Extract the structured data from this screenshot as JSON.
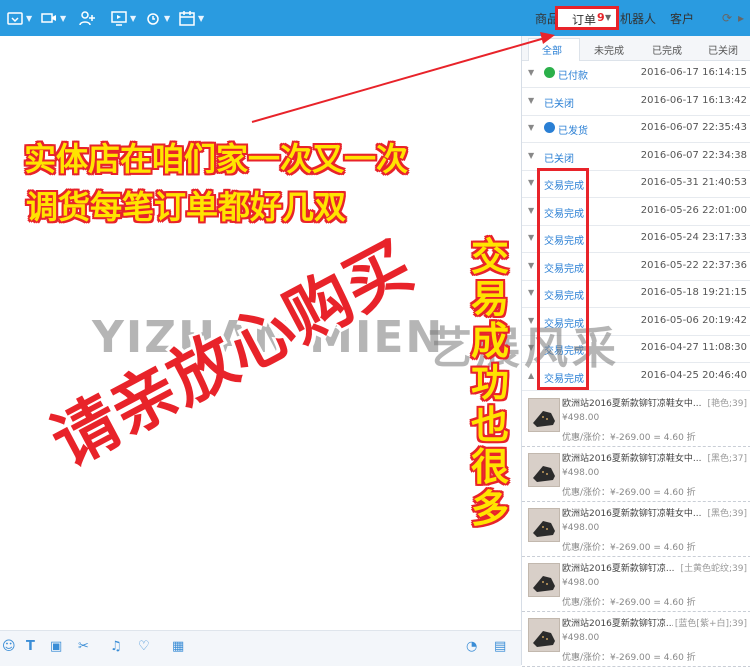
{
  "toolbar": {
    "icons": [
      "folder-icon",
      "video-icon",
      "add-contact-icon",
      "screen-share-icon",
      "alarm-icon",
      "calendar-icon"
    ]
  },
  "tabs": {
    "goods": "商品",
    "orders": "订单",
    "orders_badge": "9",
    "robot": "机器人",
    "customer": "客户"
  },
  "subtabs": {
    "all": "全部",
    "unfinished": "未完成",
    "finished": "已完成",
    "closed": "已关闭"
  },
  "orders": [
    {
      "status": "已付款",
      "date": "2016-06-17 16:14:15",
      "icon": "check-icon",
      "icon_color": "#2bb04a"
    },
    {
      "status": "已关闭",
      "date": "2016-06-17 16:13:42"
    },
    {
      "status": "已发货",
      "date": "2016-06-07 22:35:43",
      "icon": "truck-icon",
      "icon_color": "#2a7fd4"
    },
    {
      "status": "已关闭",
      "date": "2016-06-07 22:34:38"
    },
    {
      "status": "交易完成",
      "date": "2016-05-31 21:40:53"
    },
    {
      "status": "交易完成",
      "date": "2016-05-26 22:01:00"
    },
    {
      "status": "交易完成",
      "date": "2016-05-24 23:17:33"
    },
    {
      "status": "交易完成",
      "date": "2016-05-22 22:37:36"
    },
    {
      "status": "交易完成",
      "date": "2016-05-18 19:21:15"
    },
    {
      "status": "交易完成",
      "date": "2016-05-06 20:19:42"
    },
    {
      "status": "交易完成",
      "date": "2016-04-27 11:08:30"
    },
    {
      "status": "交易完成",
      "date": "2016-04-25 20:46:40"
    }
  ],
  "items": [
    {
      "title": "欧洲站2016夏新款铆钉凉鞋女中...",
      "sku": "[艳色;39]",
      "price": "¥498.00",
      "discount": "优惠/涨价：¥-269.00 = 4.60 折"
    },
    {
      "title": "欧洲站2016夏新款铆钉凉鞋女中...",
      "sku": "[黑色;37]",
      "price": "¥498.00",
      "discount": "优惠/涨价：¥-269.00 = 4.60 折"
    },
    {
      "title": "欧洲站2016夏新款铆钉凉鞋女中...",
      "sku": "[黑色;39]",
      "price": "¥498.00",
      "discount": "优惠/涨价：¥-269.00 = 4.60 折"
    },
    {
      "title": "欧洲站2016夏新款铆钉凉...",
      "sku": "[土黄色蛇纹;39]",
      "price": "¥498.00",
      "discount": "优惠/涨价：¥-269.00 = 4.60 折"
    },
    {
      "title": "欧洲站2016夏新款铆钉凉...",
      "sku": "[蓝色[紫+白];39]",
      "price": "¥498.00",
      "discount": "优惠/涨价：¥-269.00 = 4.60 折"
    }
  ],
  "bottom_bar": {
    "icons": [
      "emoji-icon",
      "font-icon",
      "image-icon",
      "scissors-icon",
      "bell-icon",
      "heart-icon",
      "calculator-icon",
      "chat-history-icon",
      "doc-icon"
    ]
  },
  "overlay": {
    "caption_line1": "实体店在咱们家一次又一次",
    "caption_line2": "调货每笔订单都好几双",
    "watermark_latin": "YIZHAN MIEN",
    "watermark_cn": "艺展风采",
    "big_text": "请亲放心购买",
    "vertical_text": "交易成功也很多",
    "accent_red": "#e8232a",
    "accent_yellow": "#ffe400"
  }
}
